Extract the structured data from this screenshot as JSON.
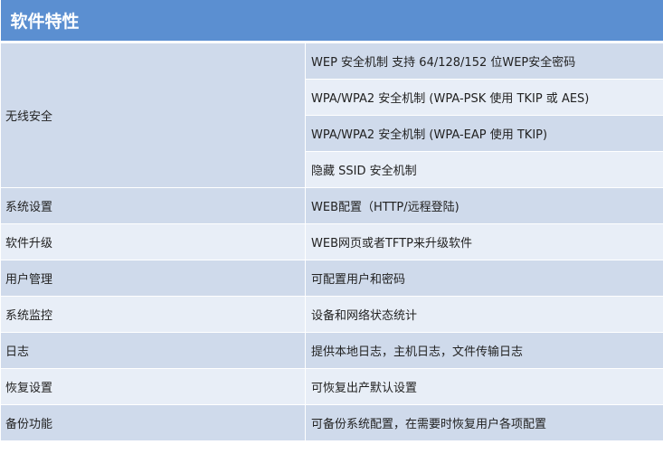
{
  "title": "软件特性",
  "security": {
    "feature": "无线安全",
    "items": [
      "WEP 安全机制 支持 64/128/152 位WEP安全密码",
      "WPA/WPA2 安全机制 (WPA-PSK 使用 TKIP 或 AES)",
      "WPA/WPA2 安全机制 (WPA-EAP 使用 TKIP)",
      "隐藏 SSID  安全机制"
    ]
  },
  "rows": [
    {
      "feature": "系统设置",
      "value": "WEB配置（HTTP/远程登陆)"
    },
    {
      "feature": "软件升级",
      "value": "WEB网页或者TFTP来升级软件"
    },
    {
      "feature": "用户管理",
      "value": "可配置用户和密码"
    },
    {
      "feature": "系统监控",
      "value": "设备和网络状态统计"
    },
    {
      "feature": "日志",
      "value": "提供本地日志，主机日志，文件传输日志"
    },
    {
      "feature": "恢复设置",
      "value": "可恢复出产默认设置"
    },
    {
      "feature": "备份功能",
      "value": "可备份系统配置，在需要时恢复用户各项配置"
    }
  ],
  "colors": {
    "header": "#5b8fd1",
    "row_dark": "#cfdaeb",
    "row_light": "#e8eef7"
  }
}
